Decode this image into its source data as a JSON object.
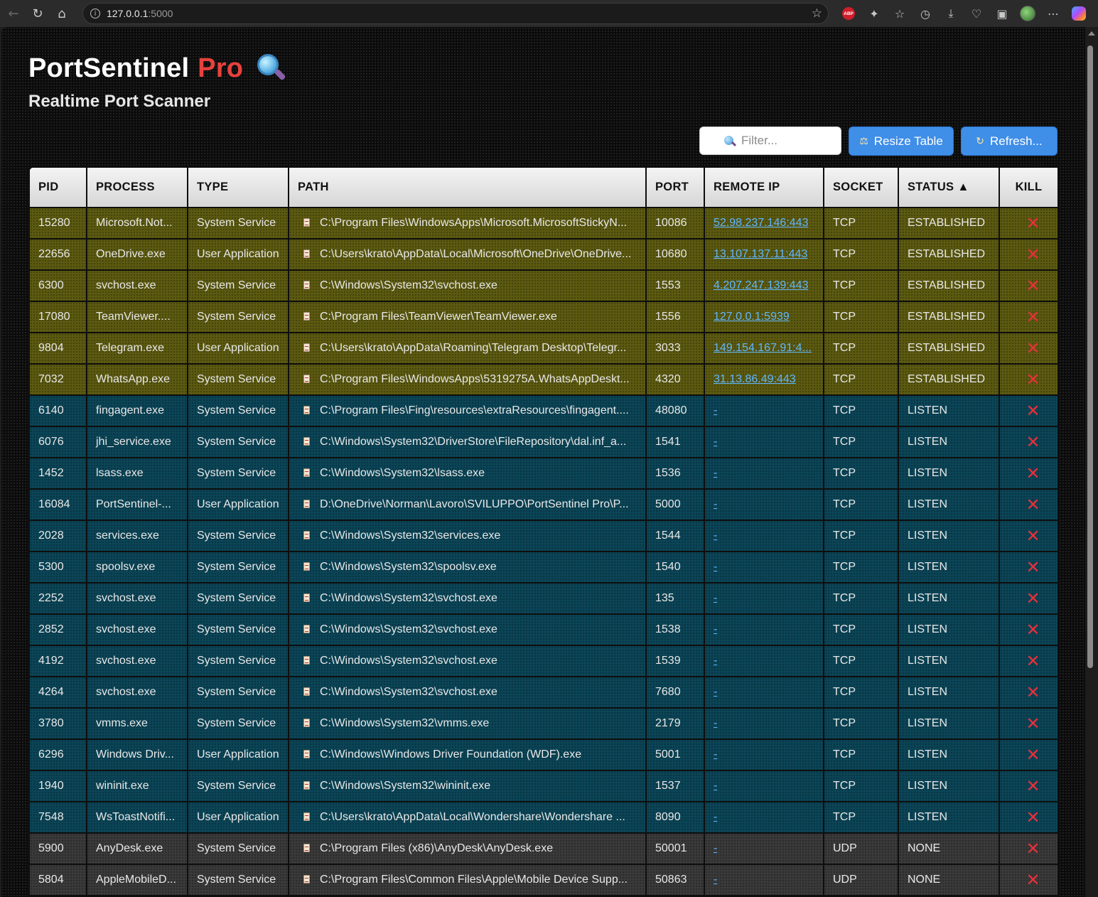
{
  "browser": {
    "url_host": "127.0.0.1",
    "url_port": ":5000",
    "abp_label": "ABP"
  },
  "app": {
    "title": "PortSentinel",
    "title_accent": "Pro",
    "subtitle": "Realtime Port Scanner",
    "accent_color": "#e8413c"
  },
  "toolbar": {
    "filter_placeholder": "Filter...",
    "resize_label": "Resize Table",
    "refresh_label": "Refresh..."
  },
  "table": {
    "columns": [
      "PID",
      "PROCESS",
      "TYPE",
      "PATH",
      "PORT",
      "REMOTE IP",
      "SOCKET",
      "STATUS ▲",
      "KILL"
    ],
    "sorted_column": "STATUS",
    "sort_direction": "ascending",
    "status_colors": {
      "ESTABLISHED": "#5c5a10",
      "LISTEN": "#0b4557",
      "NONE": "#3a3a3a"
    },
    "rows": [
      {
        "pid": "15280",
        "process": "Microsoft.Not...",
        "type": "System Service",
        "path": "C:\\Program Files\\WindowsApps\\Microsoft.MicrosoftStickyN...",
        "port": "10086",
        "remote": "52.98.237.146:443",
        "socket": "TCP",
        "status": "ESTABLISHED"
      },
      {
        "pid": "22656",
        "process": "OneDrive.exe",
        "type": "User Application",
        "path": "C:\\Users\\krato\\AppData\\Local\\Microsoft\\OneDrive\\OneDrive...",
        "port": "10680",
        "remote": "13.107.137.11:443",
        "socket": "TCP",
        "status": "ESTABLISHED"
      },
      {
        "pid": "6300",
        "process": "svchost.exe",
        "type": "System Service",
        "path": "C:\\Windows\\System32\\svchost.exe",
        "port": "1553",
        "remote": "4.207.247.139:443",
        "socket": "TCP",
        "status": "ESTABLISHED"
      },
      {
        "pid": "17080",
        "process": "TeamViewer....",
        "type": "System Service",
        "path": "C:\\Program Files\\TeamViewer\\TeamViewer.exe",
        "port": "1556",
        "remote": "127.0.0.1:5939",
        "socket": "TCP",
        "status": "ESTABLISHED"
      },
      {
        "pid": "9804",
        "process": "Telegram.exe",
        "type": "User Application",
        "path": "C:\\Users\\krato\\AppData\\Roaming\\Telegram Desktop\\Telegr...",
        "port": "3033",
        "remote": "149.154.167.91:4...",
        "socket": "TCP",
        "status": "ESTABLISHED"
      },
      {
        "pid": "7032",
        "process": "WhatsApp.exe",
        "type": "System Service",
        "path": "C:\\Program Files\\WindowsApps\\5319275A.WhatsAppDeskt...",
        "port": "4320",
        "remote": "31.13.86.49:443",
        "socket": "TCP",
        "status": "ESTABLISHED"
      },
      {
        "pid": "6140",
        "process": "fingagent.exe",
        "type": "System Service",
        "path": "C:\\Program Files\\Fing\\resources\\extraResources\\fingagent....",
        "port": "48080",
        "remote": "-",
        "socket": "TCP",
        "status": "LISTEN"
      },
      {
        "pid": "6076",
        "process": "jhi_service.exe",
        "type": "System Service",
        "path": "C:\\Windows\\System32\\DriverStore\\FileRepository\\dal.inf_a...",
        "port": "1541",
        "remote": "-",
        "socket": "TCP",
        "status": "LISTEN"
      },
      {
        "pid": "1452",
        "process": "lsass.exe",
        "type": "System Service",
        "path": "C:\\Windows\\System32\\lsass.exe",
        "port": "1536",
        "remote": "-",
        "socket": "TCP",
        "status": "LISTEN"
      },
      {
        "pid": "16084",
        "process": "PortSentinel-...",
        "type": "User Application",
        "path": "D:\\OneDrive\\Norman\\Lavoro\\SVILUPPO\\PortSentinel Pro\\P...",
        "port": "5000",
        "remote": "-",
        "socket": "TCP",
        "status": "LISTEN"
      },
      {
        "pid": "2028",
        "process": "services.exe",
        "type": "System Service",
        "path": "C:\\Windows\\System32\\services.exe",
        "port": "1544",
        "remote": "-",
        "socket": "TCP",
        "status": "LISTEN"
      },
      {
        "pid": "5300",
        "process": "spoolsv.exe",
        "type": "System Service",
        "path": "C:\\Windows\\System32\\spoolsv.exe",
        "port": "1540",
        "remote": "-",
        "socket": "TCP",
        "status": "LISTEN"
      },
      {
        "pid": "2252",
        "process": "svchost.exe",
        "type": "System Service",
        "path": "C:\\Windows\\System32\\svchost.exe",
        "port": "135",
        "remote": "-",
        "socket": "TCP",
        "status": "LISTEN"
      },
      {
        "pid": "2852",
        "process": "svchost.exe",
        "type": "System Service",
        "path": "C:\\Windows\\System32\\svchost.exe",
        "port": "1538",
        "remote": "-",
        "socket": "TCP",
        "status": "LISTEN"
      },
      {
        "pid": "4192",
        "process": "svchost.exe",
        "type": "System Service",
        "path": "C:\\Windows\\System32\\svchost.exe",
        "port": "1539",
        "remote": "-",
        "socket": "TCP",
        "status": "LISTEN"
      },
      {
        "pid": "4264",
        "process": "svchost.exe",
        "type": "System Service",
        "path": "C:\\Windows\\System32\\svchost.exe",
        "port": "7680",
        "remote": "-",
        "socket": "TCP",
        "status": "LISTEN"
      },
      {
        "pid": "3780",
        "process": "vmms.exe",
        "type": "System Service",
        "path": "C:\\Windows\\System32\\vmms.exe",
        "port": "2179",
        "remote": "-",
        "socket": "TCP",
        "status": "LISTEN"
      },
      {
        "pid": "6296",
        "process": "Windows Driv...",
        "type": "User Application",
        "path": "C:\\Windows\\Windows Driver Foundation (WDF).exe",
        "port": "5001",
        "remote": "-",
        "socket": "TCP",
        "status": "LISTEN"
      },
      {
        "pid": "1940",
        "process": "wininit.exe",
        "type": "System Service",
        "path": "C:\\Windows\\System32\\wininit.exe",
        "port": "1537",
        "remote": "-",
        "socket": "TCP",
        "status": "LISTEN"
      },
      {
        "pid": "7548",
        "process": "WsToastNotifi...",
        "type": "User Application",
        "path": "C:\\Users\\krato\\AppData\\Local\\Wondershare\\Wondershare ...",
        "port": "8090",
        "remote": "-",
        "socket": "TCP",
        "status": "LISTEN"
      },
      {
        "pid": "5900",
        "process": "AnyDesk.exe",
        "type": "System Service",
        "path": "C:\\Program Files (x86)\\AnyDesk\\AnyDesk.exe",
        "port": "50001",
        "remote": "-",
        "socket": "UDP",
        "status": "NONE"
      },
      {
        "pid": "5804",
        "process": "AppleMobileD...",
        "type": "System Service",
        "path": "C:\\Program Files\\Common Files\\Apple\\Mobile Device Supp...",
        "port": "50863",
        "remote": "-",
        "socket": "UDP",
        "status": "NONE"
      }
    ]
  }
}
